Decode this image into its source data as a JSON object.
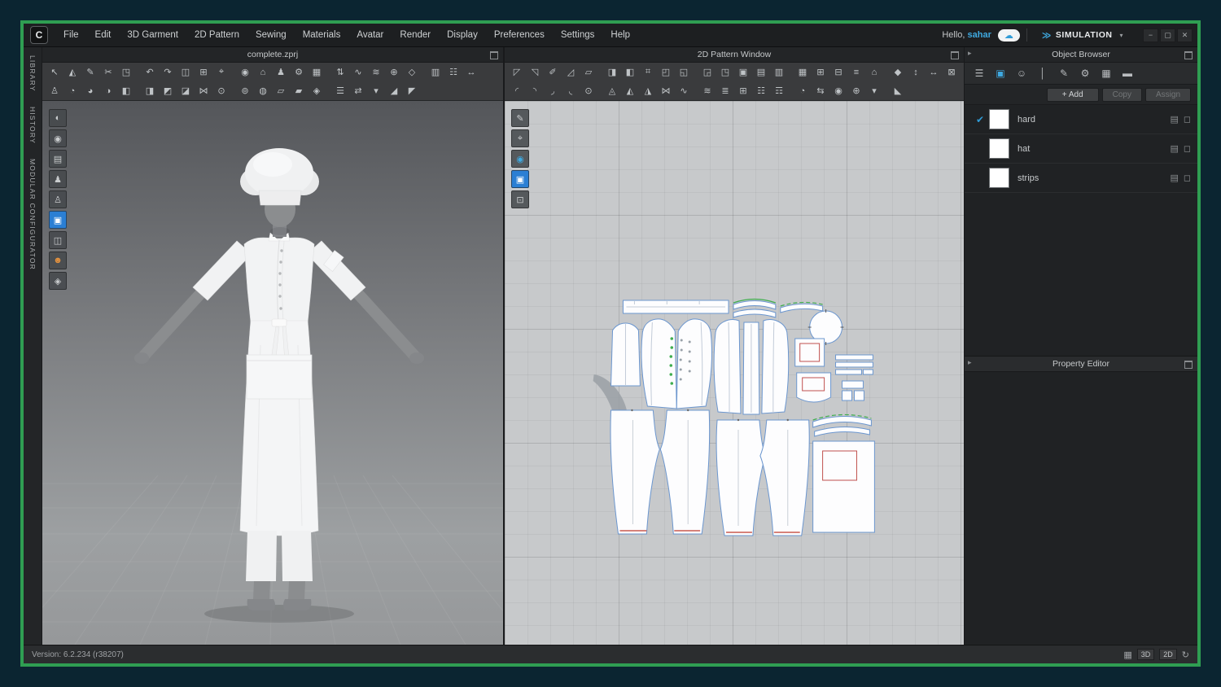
{
  "ui": {
    "arrow": "▸"
  },
  "titlebar": {
    "logo": "C",
    "menus": [
      "File",
      "Edit",
      "3D Garment",
      "2D Pattern",
      "Sewing",
      "Materials",
      "Avatar",
      "Render",
      "Display",
      "Preferences",
      "Settings",
      "Help"
    ],
    "greeting": "Hello,",
    "username": "sahar",
    "cloud_icon": "☁",
    "sim_chevrons": "≫",
    "simulation": "SIMULATION",
    "sim_caret": "▾",
    "window_controls": {
      "minimize": "−",
      "maximize": "▢",
      "close": "✕"
    }
  },
  "left_rail": {
    "tabs": [
      "LIBRARY",
      "HISTORY",
      "MODULAR CONFIGURATOR"
    ]
  },
  "viewport3d": {
    "title": "complete.zprj",
    "toolbar_row1": [
      "↖",
      "◭",
      "✎",
      "✂",
      "◳",
      "↶",
      "↷",
      "◫",
      "⊞",
      "⌖",
      "◉",
      "⌂",
      "♟",
      "⚙",
      "▦",
      "⇅",
      "∿",
      "≋",
      "⊕",
      "◇",
      "▥",
      "☷",
      "↔"
    ],
    "toolbar_row2": [
      "♙",
      "◔",
      "◕",
      "◑",
      "◧",
      "◨",
      "◩",
      "◪",
      "⋈",
      "⊙",
      "⊚",
      "◍",
      "▱",
      "▰",
      "◈",
      "☰",
      "⇄",
      "▾",
      "◢",
      "◤"
    ],
    "side_icons": [
      "◐",
      "◉",
      "▤",
      "♟",
      "♙",
      "▣",
      "◫",
      "☻",
      "◈"
    ]
  },
  "viewport2d": {
    "title": "2D Pattern Window",
    "toolbar_row1": [
      "◸",
      "◹",
      "✐",
      "◿",
      "▱",
      "◨",
      "◧",
      "⌗",
      "◰",
      "◱",
      "◲",
      "◳",
      "▣",
      "▤",
      "▥",
      "▦",
      "⊞",
      "⊟",
      "≡",
      "⌂",
      "◆",
      "↕",
      "↔",
      "⊠"
    ],
    "toolbar_row2": [
      "◜",
      "◝",
      "◞",
      "◟",
      "⊙",
      "◬",
      "◭",
      "◮",
      "⋈",
      "∿",
      "≋",
      "≣",
      "⊞",
      "☷",
      "☶",
      "◔",
      "⇆",
      "◉",
      "⊕",
      "▾",
      "◣"
    ],
    "side_icons": [
      "✎",
      "⌖",
      "◉",
      "▣",
      "⊡"
    ]
  },
  "object_browser": {
    "title": "Object Browser",
    "tab_icons": [
      "☰",
      "▣",
      "☺",
      "│",
      "✎",
      "⚙",
      "▦",
      "▬"
    ],
    "add": "+ Add",
    "copy": "Copy",
    "assign": "Assign",
    "check": "✔",
    "row_icon_a": "▤",
    "row_icon_b": "◻",
    "items": [
      {
        "name": "hard",
        "checked": true
      },
      {
        "name": "hat",
        "checked": false
      },
      {
        "name": "strips",
        "checked": false
      }
    ]
  },
  "property_editor": {
    "title": "Property Editor"
  },
  "statusbar": {
    "version": "Version: 6.2.234 (r38207)",
    "grid_icon": "▦",
    "btn_3d": "3D",
    "btn_2d": "2D",
    "refresh": "↻"
  },
  "colors": {
    "frame_green": "#2f9e52",
    "frame_teal": "#0b2531",
    "accent_blue": "#2f9bd6",
    "pattern_outline_blue": "#6b96cf",
    "stitch_green": "#3fae4f",
    "hem_red": "#c0392b"
  }
}
